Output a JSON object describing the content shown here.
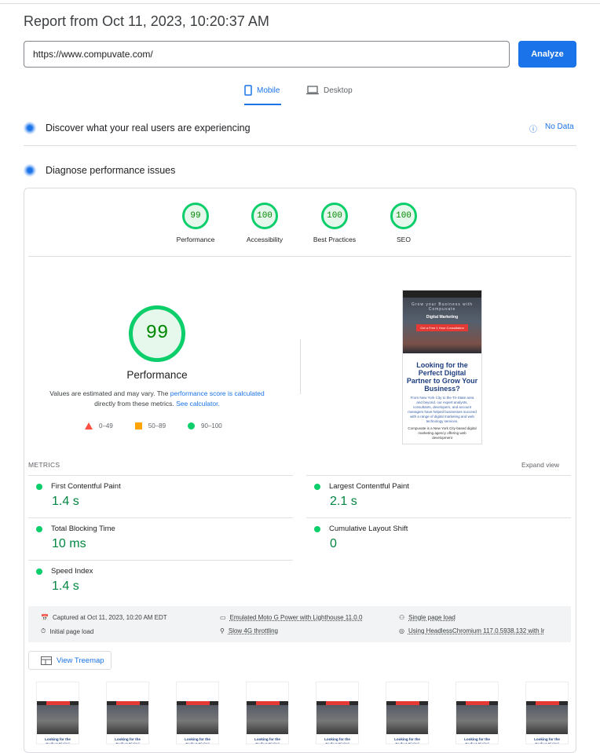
{
  "header": {
    "title": "Report from Oct 11, 2023, 10:20:37 AM",
    "url_value": "https://www.compuvate.com/",
    "analyze_label": "Analyze"
  },
  "tabs": [
    {
      "label": "Mobile",
      "icon": "phone-icon",
      "active": true
    },
    {
      "label": "Desktop",
      "icon": "laptop-icon",
      "active": false
    }
  ],
  "sections": {
    "field": "Discover what your real users are experiencing",
    "no_data": "No Data",
    "lab": "Diagnose performance issues"
  },
  "gauges": [
    {
      "label": "Performance",
      "score": "99"
    },
    {
      "label": "Accessibility",
      "score": "100"
    },
    {
      "label": "Best Practices",
      "score": "100"
    },
    {
      "label": "SEO",
      "score": "100"
    }
  ],
  "colors": {
    "pass": "#0cce6b",
    "accent": "#1a73e8",
    "fail": "#ff4e42",
    "average": "#ffa400"
  },
  "perf": {
    "score": "99",
    "label": "Performance",
    "desc_1": "Values are estimated and may vary. The ",
    "desc_link1": "performance score is calculated",
    "desc_2": " directly from these metrics. ",
    "desc_link2": "See calculator.",
    "legend": [
      "0–49",
      "50–89",
      "90–100"
    ]
  },
  "screenshot": {
    "hero_title": "Grow your Business with Compuvate",
    "hero_sub": "Digital Marketing",
    "cta": "Get a Free 1 Hour Consultation",
    "heading": "Looking for the Perfect Digital Partner to Grow Your Business?",
    "body": "From New York City to the Tri-State area and beyond, our expert analysts, consultants, developers, and account managers have helped businesses succeed with a range of digital marketing and web technology services.",
    "body2": "Compuvate is a New York City-based digital marketing agency offering web development"
  },
  "metrics": {
    "label": "METRICS",
    "expand": "Expand view",
    "items": [
      {
        "name": "First Contentful Paint",
        "value": "1.4 s"
      },
      {
        "name": "Largest Contentful Paint",
        "value": "2.1 s"
      },
      {
        "name": "Total Blocking Time",
        "value": "10 ms"
      },
      {
        "name": "Cumulative Layout Shift",
        "value": "0"
      },
      {
        "name": "Speed Index",
        "value": "1.4 s"
      }
    ]
  },
  "info": {
    "captured": "Captured at Oct 11, 2023, 10:20 AM EDT",
    "initial": "Initial page load",
    "device": "Emulated Moto G Power with Lighthouse 11.0.0",
    "throttling": "Slow 4G throttling",
    "single": "Single page load",
    "browser": "Using HeadlessChromium 117.0.5938.132 with lr"
  },
  "treemap": "View Treemap",
  "filmstrip_caption": "Looking for the Perfect Digital Partner to Grow Your Business?"
}
